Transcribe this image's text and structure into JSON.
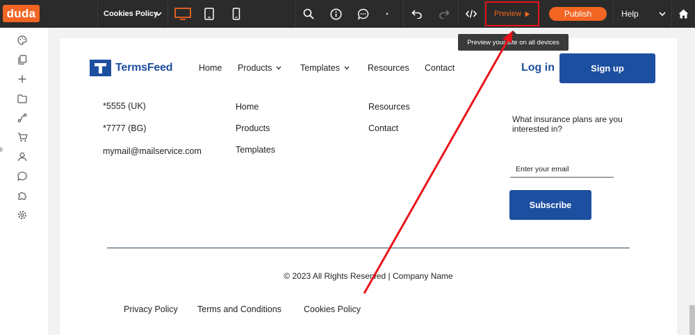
{
  "toolbar": {
    "logo": "duda",
    "page_selector": "Cookies Policy",
    "preview_label": "Preview",
    "publish_label": "Publish",
    "help_label": "Help",
    "tooltip": "Preview your site on all devices"
  },
  "site": {
    "brand": "TermsFeed",
    "nav": [
      "Home",
      "Products",
      "Templates",
      "Resources",
      "Contact"
    ],
    "login": "Log in",
    "signup": "Sign up"
  },
  "footer": {
    "contacts": [
      "*5555 (UK)",
      "*7777 (BG)",
      "mymail@mailservice.com"
    ],
    "links_col1": [
      "Home",
      "Products",
      "Templates"
    ],
    "links_col2": [
      "Resources",
      "Contact"
    ],
    "question": "What insurance plans are you interested in?",
    "email_placeholder": "Enter your email",
    "subscribe": "Subscribe",
    "copyright": "© 2023 All Rights Reserved | Company Name",
    "legal_links": [
      "Privacy Policy",
      "Terms and Conditions",
      "Cookies Policy"
    ]
  },
  "colors": {
    "accent": "#f26522",
    "brand_blue": "#1d4fa0",
    "annotation_red": "#e8141b"
  }
}
